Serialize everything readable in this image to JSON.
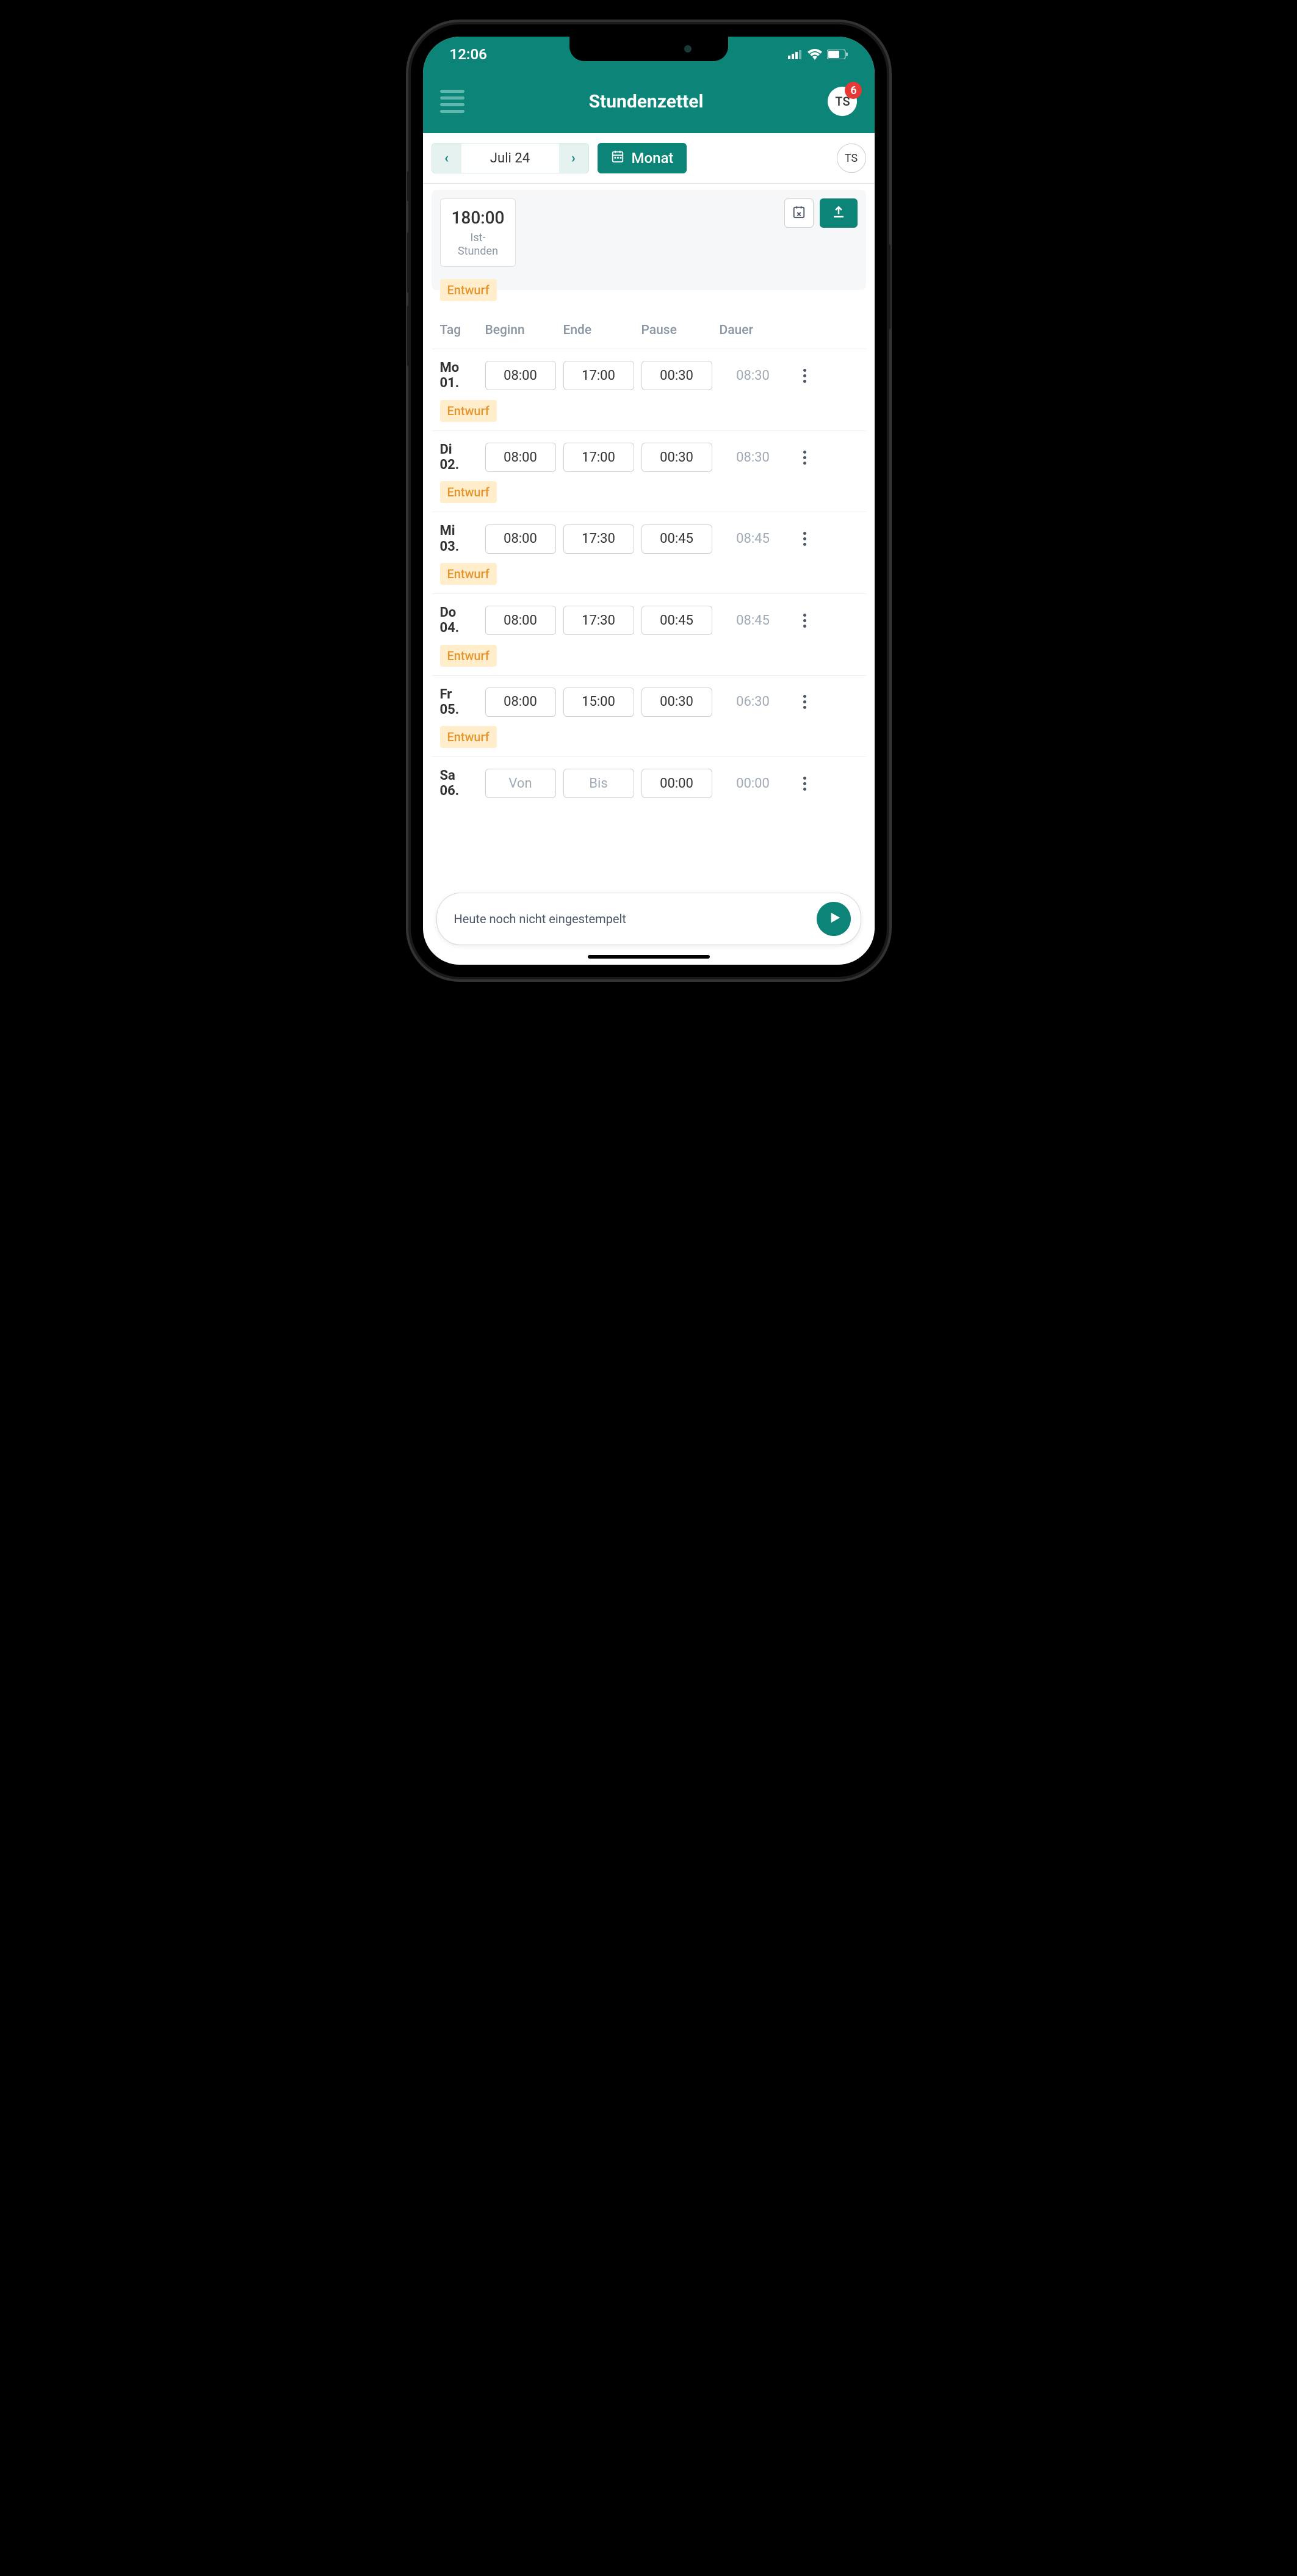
{
  "status": {
    "time": "12:06"
  },
  "header": {
    "title": "Stundenzettel",
    "avatar_initials": "TS",
    "badge_count": "6"
  },
  "nav": {
    "month_label": "Juli 24",
    "view_button": "Monat",
    "avatar_initials": "TS"
  },
  "summary": {
    "hours_value": "180:00",
    "hours_label": "Ist-\nStunden",
    "draft_label": "Entwurf"
  },
  "columns": {
    "day": "Tag",
    "begin": "Beginn",
    "end": "Ende",
    "pause": "Pause",
    "duration": "Dauer"
  },
  "rows": [
    {
      "day": "Mo\n01.",
      "begin": "08:00",
      "end": "17:00",
      "pause": "00:30",
      "duration": "08:30",
      "draft": "Entwurf",
      "placeholder": false
    },
    {
      "day": "Di\n02.",
      "begin": "08:00",
      "end": "17:00",
      "pause": "00:30",
      "duration": "08:30",
      "draft": "Entwurf",
      "placeholder": false
    },
    {
      "day": "Mi\n03.",
      "begin": "08:00",
      "end": "17:30",
      "pause": "00:45",
      "duration": "08:45",
      "draft": "Entwurf",
      "placeholder": false
    },
    {
      "day": "Do\n04.",
      "begin": "08:00",
      "end": "17:30",
      "pause": "00:45",
      "duration": "08:45",
      "draft": "Entwurf",
      "placeholder": false
    },
    {
      "day": "Fr\n05.",
      "begin": "08:00",
      "end": "15:00",
      "pause": "00:30",
      "duration": "06:30",
      "draft": "Entwurf",
      "placeholder": false
    },
    {
      "day": "Sa\n06.",
      "begin": "Von",
      "end": "Bis",
      "pause": "00:00",
      "duration": "00:00",
      "draft": "",
      "placeholder": true
    }
  ],
  "bottom": {
    "text": "Heute noch nicht eingestempelt"
  }
}
